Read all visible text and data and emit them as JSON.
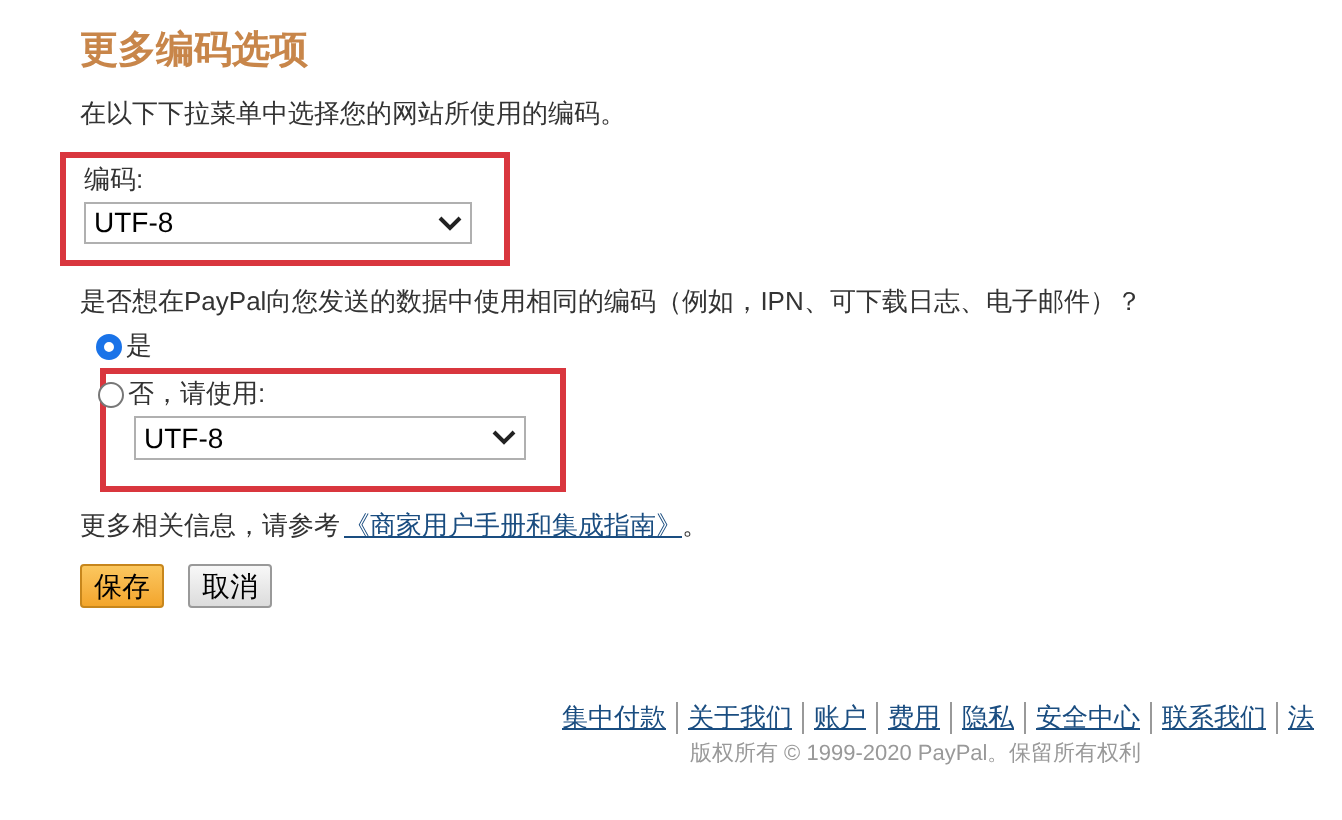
{
  "title": "更多编码选项",
  "intro": "在以下下拉菜单中选择您的网站所使用的编码。",
  "encoding_field": {
    "label": "编码:",
    "value": "UTF-8"
  },
  "question": "是否想在PayPal向您发送的数据中使用相同的编码（例如，IPN、可下载日志、电子邮件）？",
  "options": [
    {
      "label": "是",
      "selected": true
    },
    {
      "label": "否，请使用:",
      "selected": false
    }
  ],
  "alternate_field": {
    "value": "UTF-8"
  },
  "more_info": {
    "text": "更多相关信息，请参考",
    "link": "《商家用户手册和集成指南》",
    "end": "。"
  },
  "buttons": [
    {
      "label": "保存",
      "kind": "primary"
    },
    {
      "label": "取消",
      "kind": "secondary"
    }
  ],
  "footer_links": [
    "集中付款",
    "关于我们",
    "账户",
    "费用",
    "隐私",
    "安全中心",
    "联系我们",
    "法"
  ],
  "copyright": "版权所有 © 1999-2020 PayPal。保留所有权利"
}
